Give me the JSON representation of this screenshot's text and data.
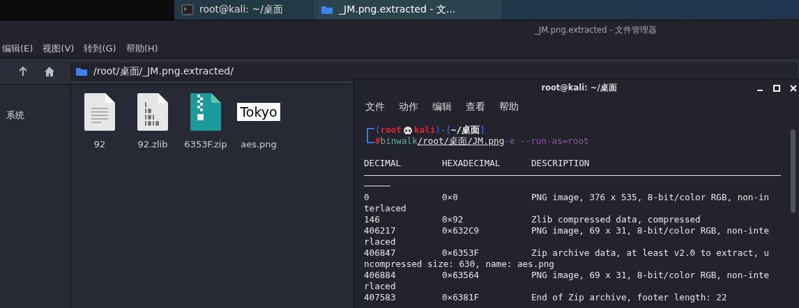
{
  "taskbar": {
    "tasks": [
      {
        "label": "root@kali: ~/桌面",
        "kind": "terminal",
        "selected": false
      },
      {
        "label": "_JM.png.extracted - 文...",
        "kind": "folder",
        "selected": true
      }
    ]
  },
  "file_manager": {
    "window": {
      "title": "_JM.png.extracted - 文件管理器"
    },
    "menu": [
      "编辑(E)",
      "视图(V)",
      "转到(G)",
      "帮助(H)"
    ],
    "address": "/root/桌面/_JM.png.extracted/",
    "sidebar": {
      "items": [
        "系统"
      ]
    },
    "files": [
      {
        "name": "92",
        "kind": "text"
      },
      {
        "name": "92.zlib",
        "kind": "binary"
      },
      {
        "name": "6353F.zip",
        "kind": "zip"
      },
      {
        "name": "aes.png",
        "kind": "image",
        "thumbnail_text": "Tokyo"
      }
    ]
  },
  "terminal": {
    "window": {
      "title": "root@kali: ~/桌面"
    },
    "menu": [
      "文件",
      "动作",
      "编辑",
      "查看",
      "帮助"
    ],
    "prompt": [
      {
        "text": "(",
        "kind": "bracket"
      },
      {
        "text": "root",
        "kind": "user"
      },
      {
        "text": "kali",
        "kind": "host"
      },
      {
        "text": ")-[",
        "kind": "bracket"
      },
      {
        "text": "~/桌面",
        "kind": "dir"
      },
      {
        "text": "]",
        "kind": "bracket"
      }
    ],
    "command": [
      {
        "text": "#",
        "kind": "hash"
      },
      {
        "text": "binwalk",
        "kind": "command"
      },
      {
        "text": "/root/桌面/JM.png",
        "kind": "path"
      },
      {
        "text": "-e --run-as=root",
        "kind": "args"
      }
    ],
    "columns": [
      "DECIMAL",
      "HEXADECIMAL",
      "DESCRIPTION"
    ],
    "output": [
      {
        "kind": "row",
        "decimal": "0",
        "hex": "0×0",
        "description": "PNG image, 376 x 535, 8-bit/color RGB, non-in"
      },
      {
        "kind": "continuation",
        "text": "terlaced"
      },
      {
        "kind": "row",
        "decimal": "146",
        "hex": "0×92",
        "description": "Zlib compressed data, compressed"
      },
      {
        "kind": "row",
        "decimal": "406217",
        "hex": "0×632C9",
        "description": "PNG image, 69 x 31, 8-bit/color RGB, non-inte"
      },
      {
        "kind": "continuation",
        "text": "rlaced"
      },
      {
        "kind": "row",
        "decimal": "406847",
        "hex": "0×6353F",
        "description": "Zip archive data, at least v2.0 to extract, u"
      },
      {
        "kind": "continuation",
        "text": "ncompressed size: 630, name: aes.png"
      },
      {
        "kind": "row",
        "decimal": "406884",
        "hex": "0×63564",
        "description": "PNG image, 69 x 31, 8-bit/color RGB, non-inte"
      },
      {
        "kind": "continuation",
        "text": "rlaced"
      },
      {
        "kind": "row",
        "decimal": "407583",
        "hex": "0×6381F",
        "description": "End of Zip archive, footer length: 22"
      }
    ]
  }
}
